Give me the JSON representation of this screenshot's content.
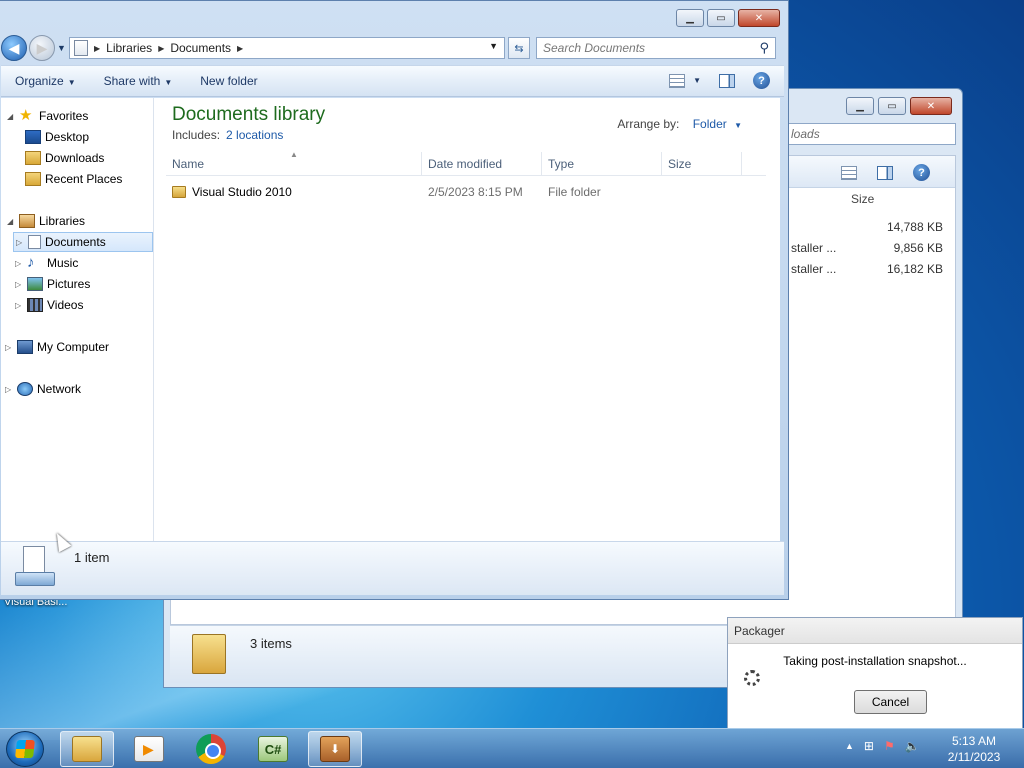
{
  "desktop": {
    "icon_label": "Visual Basi..."
  },
  "bg_window": {
    "search_placeholder": "loads",
    "size_header": "Size",
    "rows": [
      {
        "name": "",
        "size": "14,788 KB"
      },
      {
        "name": "staller ...",
        "size": "9,856 KB"
      },
      {
        "name": "staller ...",
        "size": "16,182 KB"
      }
    ],
    "status": "3 items"
  },
  "window": {
    "address": {
      "root": "Libraries",
      "current": "Documents"
    },
    "search_placeholder": "Search Documents",
    "commands": {
      "organize": "Organize",
      "share_with": "Share with",
      "new_folder": "New folder"
    },
    "nav": {
      "favorites": "Favorites",
      "desktop": "Desktop",
      "downloads": "Downloads",
      "recent_places": "Recent Places",
      "libraries": "Libraries",
      "documents": "Documents",
      "music": "Music",
      "pictures": "Pictures",
      "videos": "Videos",
      "my_computer": "My Computer",
      "network": "Network"
    },
    "library": {
      "title": "Documents library",
      "includes_label": "Includes:",
      "includes_link": "2 locations",
      "arrange_label": "Arrange by:",
      "arrange_value": "Folder"
    },
    "columns": {
      "name": "Name",
      "date_modified": "Date modified",
      "type": "Type",
      "size": "Size"
    },
    "files": [
      {
        "name": "Visual Studio 2010",
        "date_modified": "2/5/2023 8:15 PM",
        "type": "File folder",
        "size": ""
      }
    ],
    "status": "1 item"
  },
  "dialog": {
    "title": "Packager",
    "message": "Taking post-installation snapshot...",
    "cancel": "Cancel"
  },
  "taskbar": {
    "clock_time": "5:13 AM",
    "clock_date": "2/11/2023",
    "cs_label": "C#"
  }
}
